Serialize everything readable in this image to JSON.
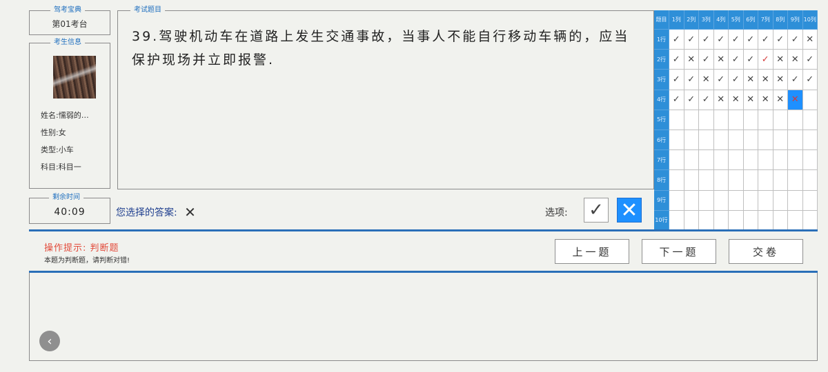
{
  "brand": {
    "legend": "驾考宝典",
    "value": "第01考台"
  },
  "examinee": {
    "legend": "考生信息",
    "name": "姓名:懦弱的…",
    "gender": "性别:女",
    "type": "类型:小车",
    "subject": "科目:科目一"
  },
  "timer": {
    "legend": "剩余时间",
    "value": "40:09"
  },
  "question": {
    "legend": "考试题目",
    "text": "39.驾驶机动车在道路上发生交通事故，当事人不能自行移动车辆的，应当保护现场并立即报警."
  },
  "answer": {
    "label": "您选择的答案:",
    "mark": "✕"
  },
  "options": {
    "label": "选项:",
    "true_glyph": "✓",
    "false_glyph": "✕"
  },
  "grid": {
    "corner": "题目",
    "columns": [
      "1列",
      "2列",
      "3列",
      "4列",
      "5列",
      "6列",
      "7列",
      "8列",
      "9列",
      "10列"
    ],
    "rows": [
      "1行",
      "2行",
      "3行",
      "4行",
      "5行",
      "6行",
      "7行",
      "8行",
      "9行",
      "10行"
    ],
    "marks": [
      [
        "✓",
        "✓",
        "✓",
        "✓",
        "✓",
        "✓",
        "✓",
        "✓",
        "✓",
        "✕"
      ],
      [
        "✓",
        "✕",
        "✓",
        "✕",
        "✓",
        "✓",
        "✓",
        "✕",
        "✕",
        "✓"
      ],
      [
        "✓",
        "✓",
        "✕",
        "✓",
        "✓",
        "✕",
        "✕",
        "✕",
        "✓",
        "✓"
      ],
      [
        "✓",
        "✓",
        "✓",
        "✕",
        "✕",
        "✕",
        "✕",
        "✕",
        "✕",
        ""
      ],
      [
        "",
        "",
        "",
        "",
        "",
        "",
        "",
        "",
        "",
        ""
      ],
      [
        "",
        "",
        "",
        "",
        "",
        "",
        "",
        "",
        "",
        ""
      ],
      [
        "",
        "",
        "",
        "",
        "",
        "",
        "",
        "",
        "",
        ""
      ],
      [
        "",
        "",
        "",
        "",
        "",
        "",
        "",
        "",
        "",
        ""
      ],
      [
        "",
        "",
        "",
        "",
        "",
        "",
        "",
        "",
        "",
        ""
      ],
      [
        "",
        "",
        "",
        "",
        "",
        "",
        "",
        "",
        "",
        ""
      ]
    ],
    "red_marks": [
      [
        1,
        6
      ],
      [
        3,
        8
      ]
    ],
    "current": [
      3,
      8
    ]
  },
  "hint": {
    "title": "操作提示: 判断题",
    "body": "本题为判断题，请判断对错!"
  },
  "nav": {
    "prev": "上一题",
    "next": "下一题",
    "submit": "交卷"
  },
  "back_icon": "chevron-left-icon"
}
